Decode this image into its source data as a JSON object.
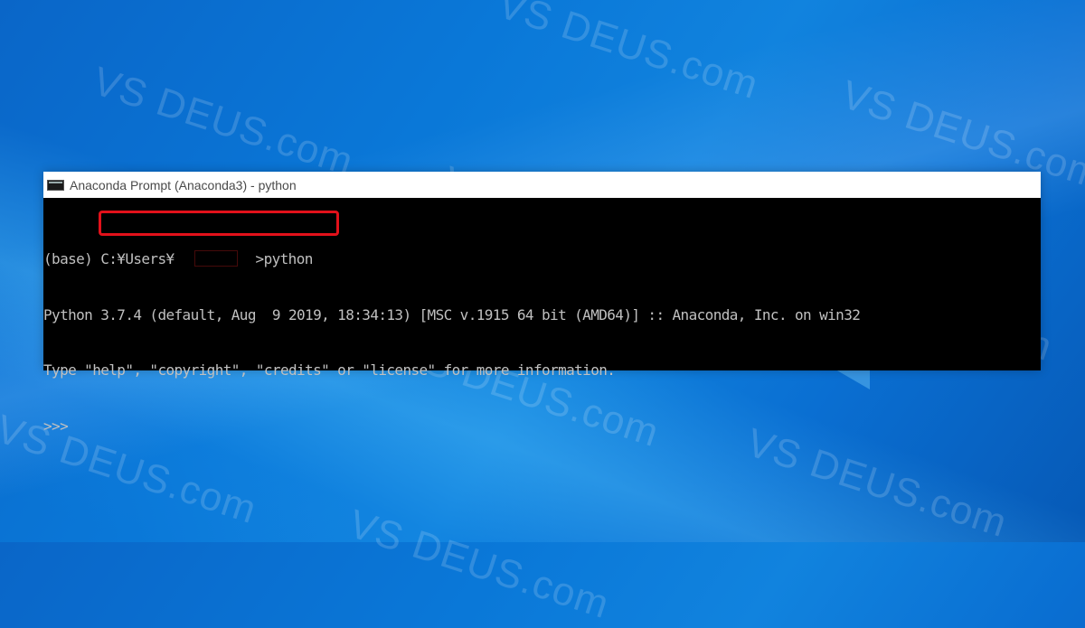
{
  "window": {
    "title": "Anaconda Prompt (Anaconda3) - python",
    "icon": "console-icon"
  },
  "console": {
    "prompt_env": "(base) ",
    "prompt_path": "C:¥Users¥",
    "prompt_command": ">python",
    "version_line": "Python 3.7.4 (default, Aug  9 2019, 18:34:13) [MSC v.1915 64 bit (AMD64)] :: Anaconda, Inc. on win32",
    "help_line": "Type \"help\", \"copyright\", \"credits\" or \"license\" for more information.",
    "repl_prompt": ">>> "
  },
  "watermark": "VS DEUS.com",
  "highlight_color": "#e2111a"
}
